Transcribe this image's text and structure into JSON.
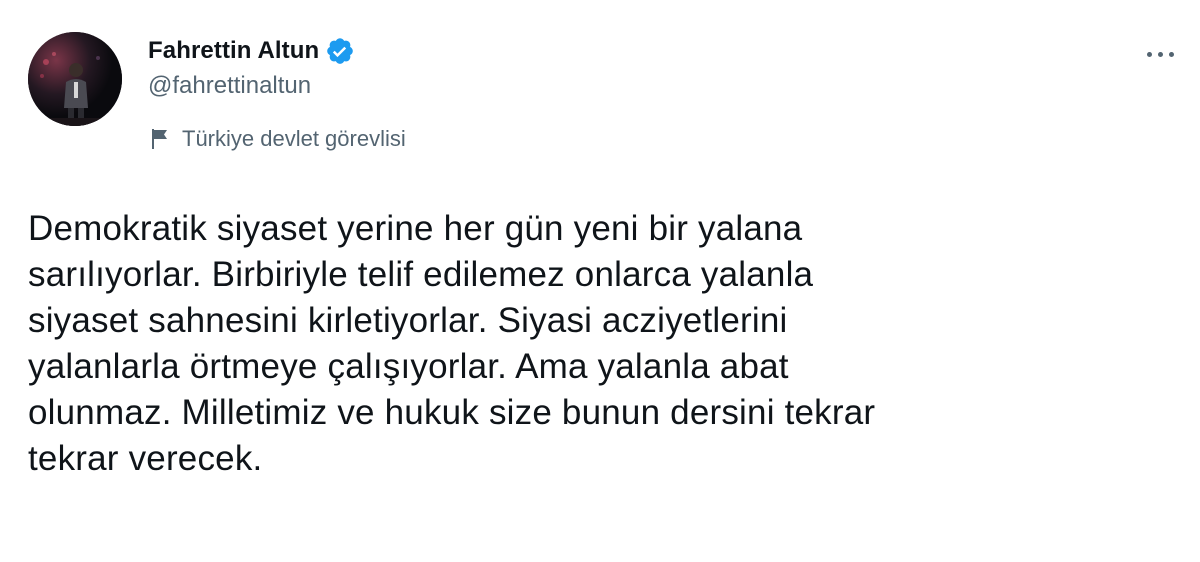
{
  "author": {
    "display_name": "Fahrettin Altun",
    "handle": "@fahrettinaltun",
    "verified_icon": "verified-badge-icon",
    "avatar": "avatar-photo",
    "label": "Türkiye devlet görevlisi",
    "label_icon": "flag-icon"
  },
  "actions": {
    "more_icon": "more-options-icon"
  },
  "tweet": {
    "text": "Demokratik siyaset yerine her gün yeni bir yalana\nsarılıyorlar. Birbiriyle telif edilemez onlarca yalanla\nsiyaset sahnesini kirletiyorlar. Siyasi acziyetlerini\nyalanlarla örtmeye çalışıyorlar. Ama yalanla abat\nolunmaz. Milletimiz ve hukuk size bunun dersini tekrar\ntekrar verecek."
  },
  "colors": {
    "text_primary": "#0f1419",
    "text_secondary": "#536471",
    "verified_blue": "#1d9bf0",
    "background": "#ffffff"
  }
}
